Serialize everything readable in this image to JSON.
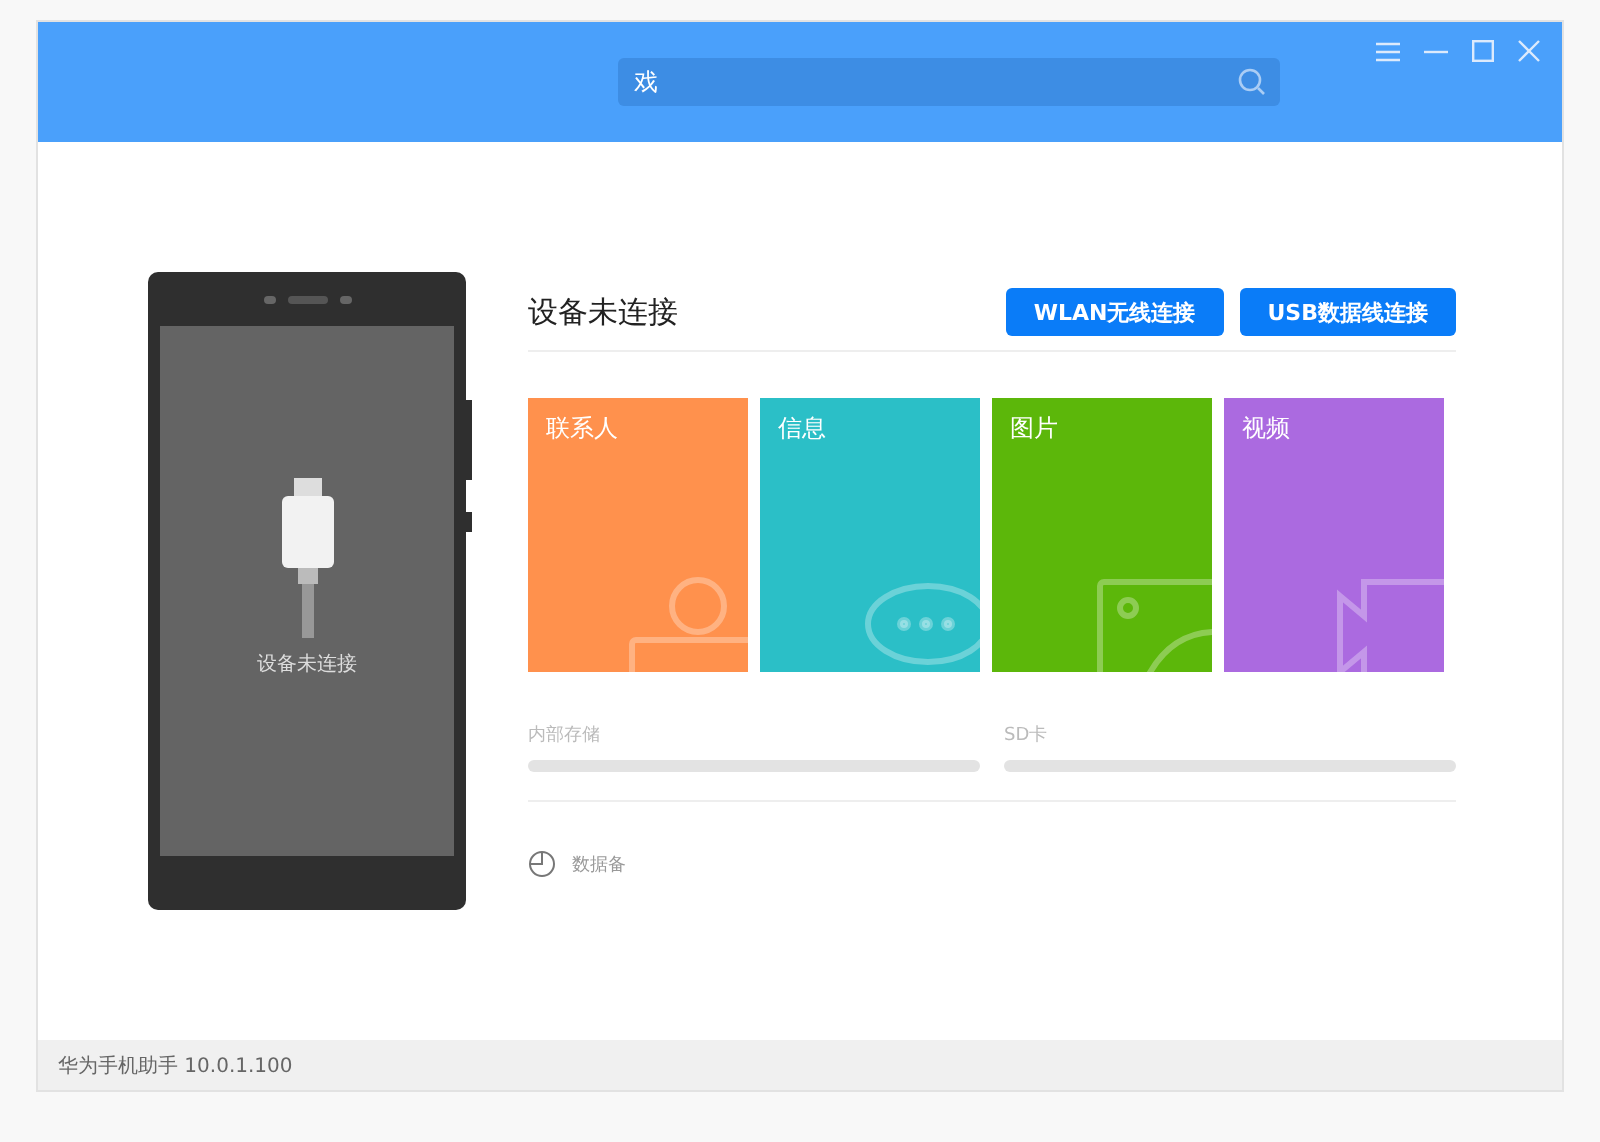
{
  "search": {
    "placeholder": "戏"
  },
  "phone": {
    "status": "设备未连接"
  },
  "device": {
    "title": "设备未连接",
    "buttons": [
      "WLAN无线连接",
      "USB数据线连接"
    ]
  },
  "tiles": [
    {
      "label": "联系人",
      "kind": "contacts",
      "color": "#ff914d"
    },
    {
      "label": "信息",
      "kind": "messages",
      "color": "#2bbfc7"
    },
    {
      "label": "图片",
      "kind": "pictures",
      "color": "#5cb70a"
    },
    {
      "label": "视频",
      "kind": "videos",
      "color": "#ab6ae0"
    }
  ],
  "storage": [
    {
      "label": "内部存储"
    },
    {
      "label": "SD卡"
    }
  ],
  "backup": {
    "label": "数据备"
  },
  "status_bar": "华为手机助手 10.0.1.100"
}
